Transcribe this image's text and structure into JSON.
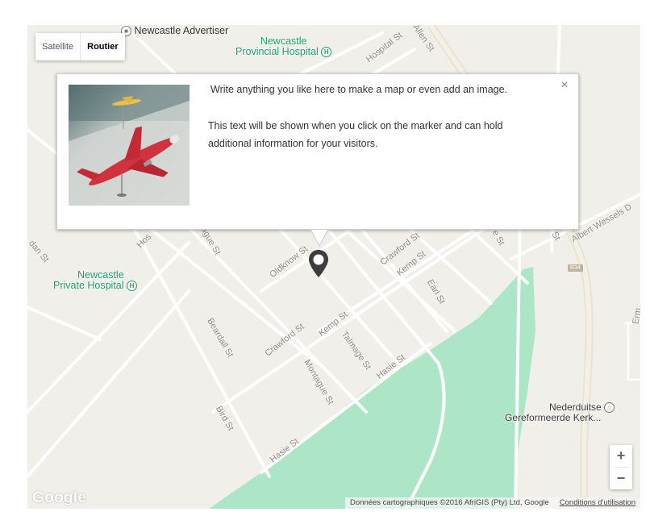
{
  "map_type": {
    "satellite": "Satellite",
    "roadmap": "Routier",
    "active": "roadmap"
  },
  "streets": {
    "allen": "Allen St",
    "hospital_top": "Hospital St",
    "oldknow": "Oldknow St",
    "crawford_upper": "Crawford St",
    "kemp_upper": "Kemp St",
    "earl": "Earl St",
    "crawford_lower": "Crawford St",
    "kemp_lower": "Kemp St",
    "talmage": "Talmage St",
    "hasie_mid": "Hasie St",
    "hasie_lower": "Hasie St",
    "beardall": "Beardall St",
    "montague_lower": "Montague St",
    "montague_upper": "ague St",
    "bird": "Bird St",
    "hos_left": "Hos",
    "dan": "dan St",
    "albert_wessels": "Albert Wessels D",
    "st_fragment_1": "St",
    "st_fragment_2": "e St",
    "route_shield": "R34",
    "right_edge": "Erm"
  },
  "places": {
    "newcastle_advertiser": "Newcastle Advertiser",
    "provincial_hospital_line1": "Newcastle",
    "provincial_hospital_line2": "Provincial Hospital",
    "private_hospital_line1": "Newcastle",
    "private_hospital_line2": "Private Hospital",
    "church_line1": "Nederduitse",
    "church_line2": "Gereformeerde Kerk..."
  },
  "info_window": {
    "line1": "Write anything you like here to make a map or even add an image.",
    "paragraph": "This text will be shown when you click on the marker and can hold additional information for your visitors.",
    "close_symbol": "×"
  },
  "zoom": {
    "in": "+",
    "out": "−"
  },
  "footer": {
    "logo": "Google",
    "attribution": "Données cartographiques ©2016 AfriGIS (Pty) Ltd, Google",
    "terms": "Conditions d'utilisation"
  },
  "colors": {
    "land": "#f1efe9",
    "park": "#ade6c6",
    "road": "#ffffff",
    "poi_green": "#1d9e6e",
    "marker": "#3d3d3d"
  },
  "icons": {
    "marker": "map-pin-icon",
    "hospital": "hospital-icon",
    "advertiser": "poi-icon",
    "church": "church-icon"
  }
}
